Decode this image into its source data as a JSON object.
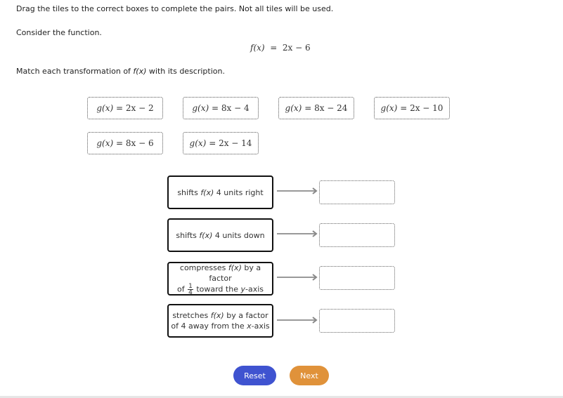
{
  "instructions": "Drag the tiles to the correct boxes to complete the pairs. Not all tiles will be used.",
  "consider": "Consider the function.",
  "function": {
    "lhs": "f(x)",
    "eq": "=",
    "rhs": "2x − 6"
  },
  "match_prompt": {
    "pre": "Match each transformation of ",
    "fx": "f(x)",
    "post": " with its description."
  },
  "tiles": [
    {
      "lhs": "g(x)",
      "eq": "=",
      "rhs": "2x − 2"
    },
    {
      "lhs": "g(x)",
      "eq": "=",
      "rhs": "8x − 4"
    },
    {
      "lhs": "g(x)",
      "eq": "=",
      "rhs": "8x − 24"
    },
    {
      "lhs": "g(x)",
      "eq": "=",
      "rhs": "2x − 10"
    },
    {
      "lhs": "g(x)",
      "eq": "=",
      "rhs": "8x − 6"
    },
    {
      "lhs": "g(x)",
      "eq": "=",
      "rhs": "2x − 14"
    }
  ],
  "descriptions": [
    {
      "line1_pre": "shifts ",
      "fx": "f(x)",
      "line1_post": " 4 units right"
    },
    {
      "line1_pre": "shifts ",
      "fx": "f(x)",
      "line1_post": " 4 units down"
    },
    {
      "line1_pre": "compresses ",
      "fx": "f(x)",
      "line1_post": " by a factor",
      "line2_pre": "of ",
      "frac_num": "1",
      "frac_den": "4",
      "line2_mid": " toward the ",
      "axis": "y",
      "line2_post": "-axis"
    },
    {
      "line1_pre": "stretches ",
      "fx": "f(x)",
      "line1_post": " by a factor",
      "line2_pre": "of 4 away from the ",
      "axis": "x",
      "line2_post": "-axis"
    }
  ],
  "drop_targets": [
    {
      "value": ""
    },
    {
      "value": ""
    },
    {
      "value": ""
    },
    {
      "value": ""
    }
  ],
  "buttons": {
    "reset": "Reset",
    "next": "Next"
  },
  "colors": {
    "reset": "#3f53d0",
    "next": "#e0923a"
  }
}
